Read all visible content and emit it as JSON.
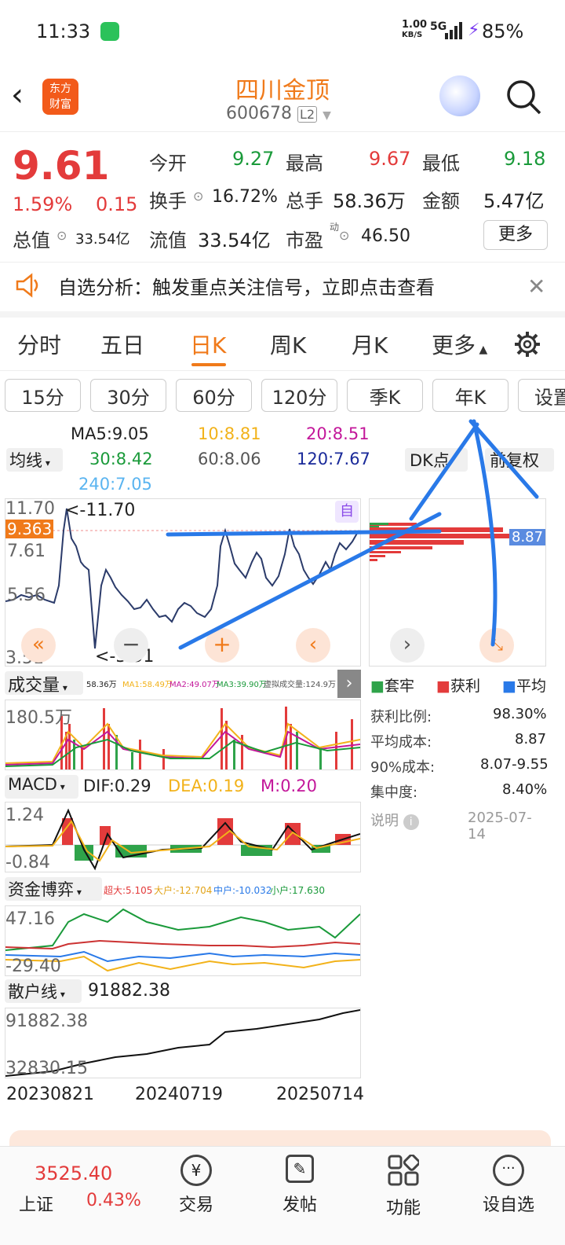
{
  "status": {
    "time": "11:33",
    "net": "1.00",
    "net_unit": "KB/S",
    "signal": "5G",
    "battery": "85%"
  },
  "header": {
    "logo_line1": "东方",
    "logo_line2": "财富",
    "title": "四川金顶",
    "code": "600678",
    "level": "L2"
  },
  "quote": {
    "price": "9.61",
    "change_pct": "1.59%",
    "change": "0.15",
    "open_label": "今开",
    "open": "9.27",
    "high_label": "最高",
    "high": "9.67",
    "low_label": "最低",
    "low": "9.18",
    "turnover_label": "换手",
    "turnover": "16.72%",
    "volume_label": "总手",
    "volume": "58.36万",
    "amount_label": "金额",
    "amount": "5.47亿",
    "mktcap_label": "总值",
    "mktcap": "33.54亿",
    "float_label": "流值",
    "float": "33.54亿",
    "pe_label": "市盈",
    "pe_sup": "动",
    "pe": "46.50",
    "more": "更多"
  },
  "notice": {
    "text": "自选分析：触发重点关注信号，立即点击查看"
  },
  "tabs": [
    "分时",
    "五日",
    "日K",
    "周K",
    "月K",
    "更多"
  ],
  "subtabs": [
    "15分",
    "30分",
    "60分",
    "120分",
    "季K",
    "年K",
    "设置"
  ],
  "ma": {
    "ma5": "MA5:9.05",
    "ma10": "10:8.81",
    "ma20": "20:8.51",
    "ma30": "30:8.42",
    "ma60": "60:8.06",
    "ma120": "120:7.67",
    "ma240": "240:7.05",
    "mode": "均线",
    "dk": "DK点",
    "fq": "前复权"
  },
  "kchart": {
    "y_max": "11.70",
    "y_max_marker": "<-11.70",
    "current": "9.363",
    "y1": "7.61",
    "y2": "5.56",
    "y_min": "3.51",
    "y_min_marker": "<-3.51",
    "badge": "自"
  },
  "chip": {
    "price_tag": "8.87",
    "legend": [
      "套牢",
      "获利",
      "平均"
    ],
    "rows": [
      {
        "k": "获利比例:",
        "v": "98.30%"
      },
      {
        "k": "平均成本:",
        "v": "8.87"
      },
      {
        "k": "90%成本:",
        "v": "8.07-9.55"
      },
      {
        "k": "集中度:",
        "v": "8.40%"
      }
    ],
    "note": "说明",
    "date": "2025-07-14"
  },
  "volume": {
    "title": "成交量",
    "info": "58.36万",
    "ma1": "MA1:58.49万",
    "ma2": "MA2:49.07万",
    "ma3": "MA3:39.90万",
    "virtual": "虚拟成交量:124.9万",
    "ymax": "180.5万"
  },
  "macd": {
    "title": "MACD",
    "dif": "DIF:0.29",
    "dea": "DEA:0.19",
    "m": "M:0.20",
    "ymax": "1.24",
    "ymin": "-0.84"
  },
  "fund": {
    "title": "资金博弈",
    "big": "超大:5.105",
    "large": "大户:-12.704",
    "mid": "中户:-10.032",
    "small": "小户:17.630",
    "ymax": "47.16",
    "ymin": "-29.40"
  },
  "retail": {
    "title": "散户线",
    "value": "91882.38",
    "ymax": "91882.38",
    "ymin": "32830.15"
  },
  "dates": [
    "20230821",
    "20240719",
    "20250714"
  ],
  "bottom": {
    "index_val": "3525.40",
    "index_name": "上证",
    "index_pct": "0.43%",
    "trade": "交易",
    "post": "发帖",
    "func": "功能",
    "fav": "设自选"
  },
  "colors": {
    "red": "#e33b3b",
    "green": "#1a9a3a",
    "orange": "#f07a1a",
    "blue": "#2979e8"
  }
}
